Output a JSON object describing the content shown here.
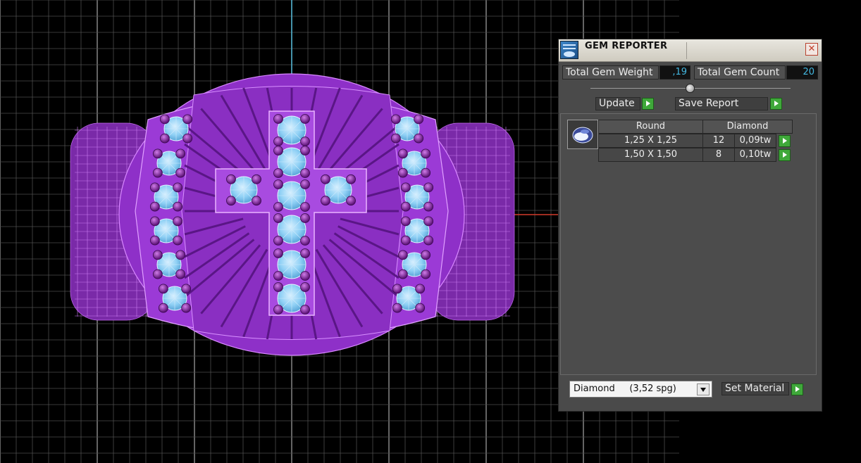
{
  "panel": {
    "title": "GEM REPORTER",
    "close_glyph": "✕",
    "total_gem_weight_label": "Total Gem Weight",
    "total_gem_weight_value": ",19",
    "total_gem_count_label": "Total Gem Count",
    "total_gem_count_value": "20",
    "update_label": "Update",
    "save_report_label": "Save Report",
    "table": {
      "shape_header": "Round",
      "material_header": "Diamond",
      "rows": [
        {
          "size": "1,25 X 1,25",
          "count": "12",
          "weight": "0,09tw"
        },
        {
          "size": "1,50 X 1,50",
          "count": "8",
          "weight": "0,10tw"
        }
      ]
    },
    "material_select_value": "Diamond     (3,52 spg)",
    "set_material_label": "Set Material"
  },
  "icons": {
    "app": "gem-reporter-icon",
    "close": "close-icon",
    "go": "play-arrow-icon",
    "gem": "round-gem-icon",
    "dropdown": "chevron-down-icon"
  },
  "colors": {
    "ring_body": "#9b3ad6",
    "gem": "#8fd0f5",
    "value_text": "#43b7e0",
    "go_button": "#3fa83a",
    "grid": "#8c8c8c",
    "axis_vertical": "#4fb8d8",
    "axis_horizontal": "#d23a2a"
  }
}
